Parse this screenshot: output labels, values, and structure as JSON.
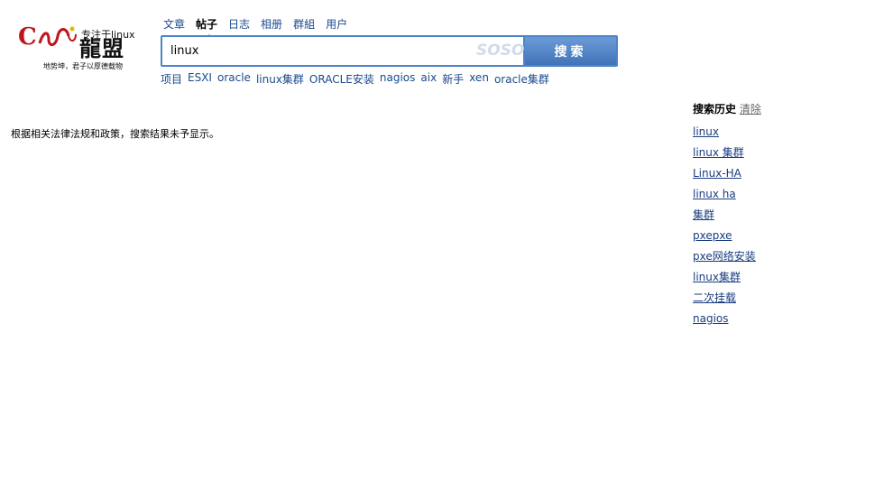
{
  "logo": {
    "c_mark": "C",
    "slogan_top": "专注于linux",
    "brand": "龍盟",
    "motto": "地势坤，君子以厚德载物"
  },
  "tabs": [
    {
      "label": "文章",
      "active": false
    },
    {
      "label": "帖子",
      "active": true
    },
    {
      "label": "日志",
      "active": false
    },
    {
      "label": "相册",
      "active": false
    },
    {
      "label": "群組",
      "active": false
    },
    {
      "label": "用户",
      "active": false
    }
  ],
  "search": {
    "value": "linux",
    "brand": "SOSO",
    "button_label": "搜索"
  },
  "suggestions": [
    "项目",
    "ESXI",
    "oracle",
    "linux集群",
    "ORACLE安装",
    "nagios",
    "aix",
    "新手",
    "xen",
    "oracle集群"
  ],
  "notice": "根据相关法律法规和政策，搜索结果未予显示。",
  "history": {
    "title": "搜索历史",
    "clear_label": "清除",
    "items": [
      "linux",
      "linux 集群",
      "Linux-HA",
      "linux ha",
      "集群",
      "pxepxe",
      "pxe网络安装",
      "linux集群",
      "二次挂载",
      "nagios"
    ]
  },
  "colors": {
    "link": "#1a4a8c",
    "search_border": "#4f83c7",
    "brand_red": "#c0141b"
  }
}
